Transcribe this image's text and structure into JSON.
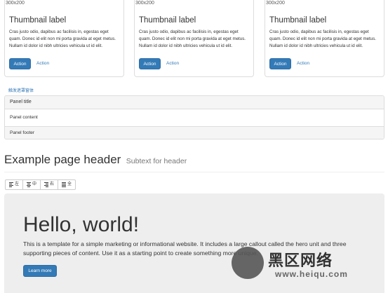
{
  "thumbnails": [
    {
      "image_label": "300x200",
      "title": "Thumbnail label",
      "text": "Cras justo odio, dapibus ac facilisis in, egestas eget quam. Donec id elit non mi porta gravida at eget metus. Nullam id dolor id nibh ultricies vehicula ut id elit.",
      "primary_label": "Action",
      "link_label": "Action"
    },
    {
      "image_label": "300x200",
      "title": "Thumbnail label",
      "text": "Cras justo odio, dapibus ac facilisis in, egestas eget quam. Donec id elit non mi porta gravida at eget metus. Nullam id dolor id nibh ultricies vehicula ut id elit.",
      "primary_label": "Action",
      "link_label": "Action"
    },
    {
      "image_label": "300x200",
      "title": "Thumbnail label",
      "text": "Cras justo odio, dapibus ac facilisis in, egestas eget quam. Donec id elit non mi porta gravida at eget metus. Nullam id dolor id nibh ultricies vehicula ut id elit.",
      "primary_label": "Action",
      "link_label": "Action"
    }
  ],
  "trigger_link": "触发遮罩窗体",
  "panel": {
    "title": "Panel title",
    "content": "Panel content",
    "footer": "Panel footer"
  },
  "page_header": {
    "title": "Example page header",
    "subtitle": "Subtext for header"
  },
  "align_buttons": [
    {
      "label": "左",
      "icon": "align-left-icon"
    },
    {
      "label": "中",
      "icon": "align-center-icon"
    },
    {
      "label": "右",
      "icon": "align-right-icon"
    },
    {
      "label": "全",
      "icon": "align-justify-icon"
    }
  ],
  "jumbotron": {
    "heading": "Hello, world!",
    "lead": "This is a template for a simple marketing or informational website. It includes a large callout called the hero unit and three supporting pieces of content. Use it as a starting point to create something more unique.",
    "button_label": "Learn more"
  },
  "watermark": {
    "text": "黑区网络",
    "url": "www.heiqu.com"
  },
  "colors": {
    "primary": "#337ab7",
    "jumbotron_bg": "#eeeeee",
    "panel_bg": "#f5f5f5"
  }
}
